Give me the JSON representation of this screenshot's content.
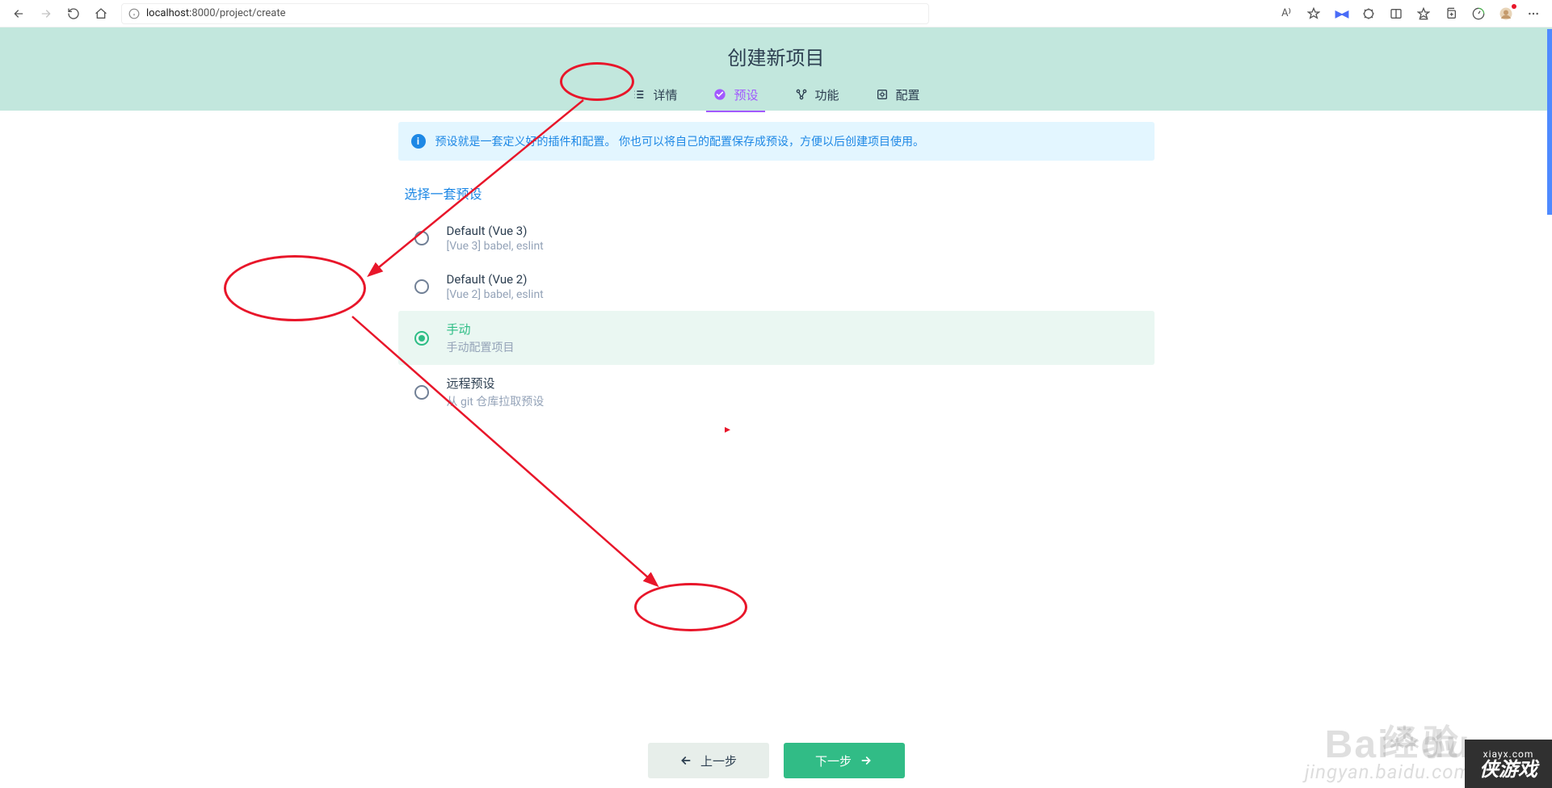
{
  "browser": {
    "url_host": "localhost:",
    "url_rest": "8000/project/create",
    "read_aloud": "A⁾"
  },
  "header": {
    "title": "创建新项目",
    "tabs": [
      {
        "label": "详情"
      },
      {
        "label": "预设"
      },
      {
        "label": "功能"
      },
      {
        "label": "配置"
      }
    ]
  },
  "banner": "预设就是一套定义好的插件和配置。 你也可以将自己的配置保存成预设，方便以后创建项目使用。",
  "section_title": "选择一套预设",
  "presets": [
    {
      "title": "Default (Vue 3)",
      "sub": "[Vue 3] babel, eslint"
    },
    {
      "title": "Default (Vue 2)",
      "sub": "[Vue 2] babel, eslint"
    },
    {
      "title": "手动",
      "sub": "手动配置项目"
    },
    {
      "title": "远程预设",
      "sub": "从 git 仓库拉取预设"
    }
  ],
  "buttons": {
    "prev": "上一步",
    "next": "下一步"
  },
  "watermark": {
    "baidu": "Bai",
    "du": "du",
    "jingyan": "经验",
    "url": "jingyan.baidu.com",
    "corner_url": "xiayx.com",
    "corner_brand": "侠游戏"
  }
}
